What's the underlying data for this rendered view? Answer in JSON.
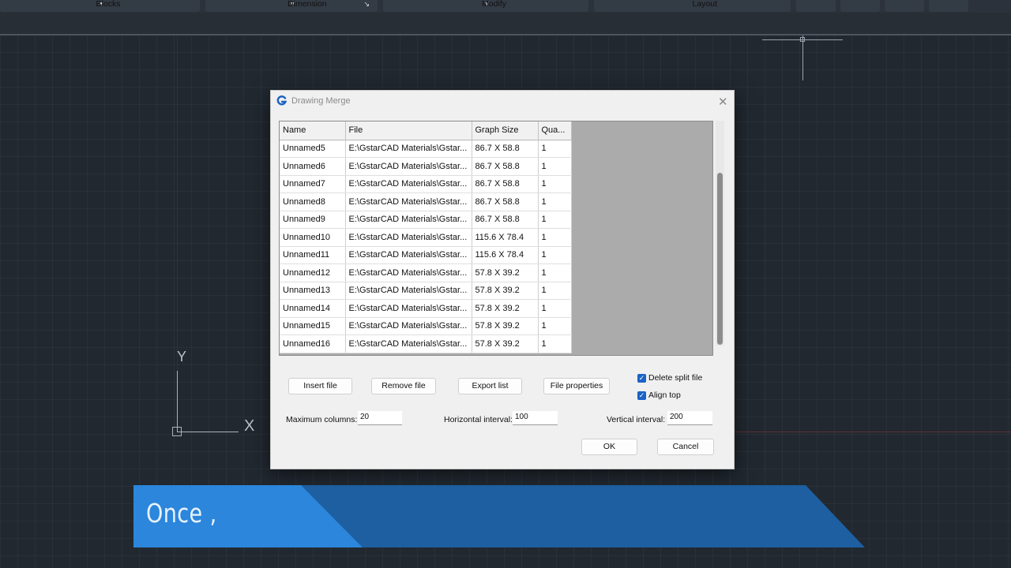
{
  "ribbon": {
    "groups": [
      {
        "label": "Blocks",
        "arrow": "▼"
      },
      {
        "label": "Dimension",
        "arrow": "▼",
        "corner": "↘"
      },
      {
        "label": "Modify",
        "arrow": "▼"
      },
      {
        "label": "Layout"
      }
    ]
  },
  "ucs": {
    "y_label": "Y",
    "x_label": "X"
  },
  "dialog": {
    "title": "Drawing Merge",
    "close": "✕",
    "columns": [
      "Name",
      "File",
      "Graph Size",
      "Qua..."
    ],
    "rows": [
      [
        "Unnamed5",
        "E:\\GstarCAD Materials\\Gstar...",
        "86.7 X 58.8",
        "1"
      ],
      [
        "Unnamed6",
        "E:\\GstarCAD Materials\\Gstar...",
        "86.7 X 58.8",
        "1"
      ],
      [
        "Unnamed7",
        "E:\\GstarCAD Materials\\Gstar...",
        "86.7 X 58.8",
        "1"
      ],
      [
        "Unnamed8",
        "E:\\GstarCAD Materials\\Gstar...",
        "86.7 X 58.8",
        "1"
      ],
      [
        "Unnamed9",
        "E:\\GstarCAD Materials\\Gstar...",
        "86.7 X 58.8",
        "1"
      ],
      [
        "Unnamed10",
        "E:\\GstarCAD Materials\\Gstar...",
        "115.6 X 78.4",
        "1"
      ],
      [
        "Unnamed11",
        "E:\\GstarCAD Materials\\Gstar...",
        "115.6 X 78.4",
        "1"
      ],
      [
        "Unnamed12",
        "E:\\GstarCAD Materials\\Gstar...",
        "57.8 X 39.2",
        "1"
      ],
      [
        "Unnamed13",
        "E:\\GstarCAD Materials\\Gstar...",
        "57.8 X 39.2",
        "1"
      ],
      [
        "Unnamed14",
        "E:\\GstarCAD Materials\\Gstar...",
        "57.8 X 39.2",
        "1"
      ],
      [
        "Unnamed15",
        "E:\\GstarCAD Materials\\Gstar...",
        "57.8 X 39.2",
        "1"
      ],
      [
        "Unnamed16",
        "E:\\GstarCAD Materials\\Gstar...",
        "57.8 X 39.2",
        "1"
      ]
    ],
    "buttons": {
      "insert": "Insert file",
      "remove": "Remove file",
      "export": "Export list",
      "properties": "File properties",
      "ok": "OK",
      "cancel": "Cancel"
    },
    "checkboxes": {
      "delete_split": {
        "label": "Delete split file",
        "checked": true
      },
      "align_top": {
        "label": "Align top",
        "checked": true
      }
    },
    "fields": {
      "max_columns": {
        "label": "Maximum columns:",
        "value": "20"
      },
      "horizontal_interval": {
        "label": "Horizontal interval:",
        "value": "100"
      },
      "vertical_interval": {
        "label": "Vertical interval:",
        "value": "200"
      }
    }
  },
  "caption": {
    "text": "Once ,"
  },
  "colors": {
    "accent": "#1a63c6",
    "banner_dark": "#1d5fa0",
    "banner_light": "#2b86dc",
    "canvas": "#212830"
  }
}
